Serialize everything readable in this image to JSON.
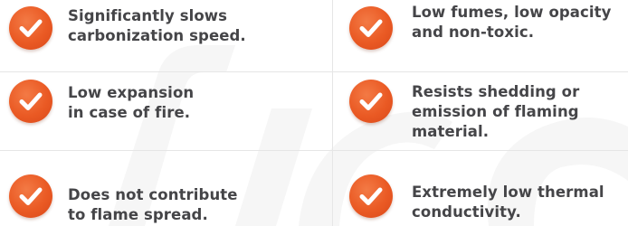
{
  "features": {
    "left": [
      {
        "text": "Significantly slows\ncarbonization speed.",
        "icon": "check-circle-icon"
      },
      {
        "text": "Low expansion\nin case of fire.",
        "icon": "check-circle-icon"
      },
      {
        "text": "Does not contribute\nto flame spread.",
        "icon": "check-circle-icon"
      }
    ],
    "right": [
      {
        "text": "Low fumes, low opacity\nand non-toxic.",
        "icon": "check-circle-icon"
      },
      {
        "text": "Resists shedding or\nemission of flaming\nmaterial.",
        "icon": "check-circle-icon"
      },
      {
        "text": "Extremely low thermal\nconductivity.",
        "icon": "check-circle-icon"
      }
    ]
  },
  "colors": {
    "accent": "#ea5a24",
    "text": "#454548",
    "divider": "#e6e6e6",
    "watermark": "#f6f6f6"
  }
}
